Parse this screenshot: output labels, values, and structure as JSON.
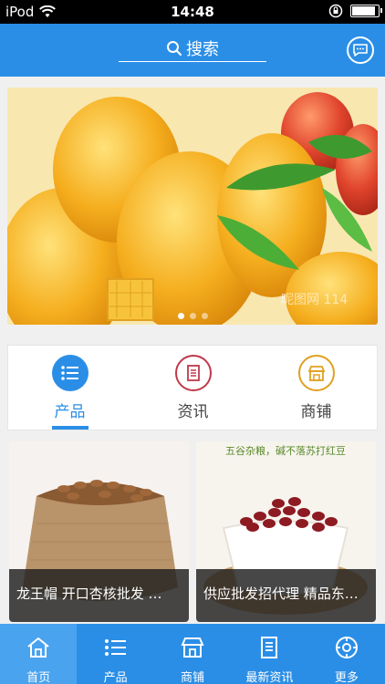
{
  "status_bar": {
    "device": "iPod",
    "time": "14:48"
  },
  "header": {
    "search_label": "搜索",
    "search_icon": "search-icon",
    "chat_icon": "chat-bubble-icon"
  },
  "banner": {
    "image_subject": "mangoes",
    "watermark": "昵图网 114",
    "slides": 3,
    "active_slide": 1
  },
  "categories": [
    {
      "label": "产品",
      "icon": "list-icon",
      "color": "#2b8ee6",
      "active": true
    },
    {
      "label": "资讯",
      "icon": "document-icon",
      "color": "#c0394b",
      "active": false
    },
    {
      "label": "商铺",
      "icon": "store-icon",
      "color": "#e0a020",
      "active": false
    }
  ],
  "products": [
    {
      "title": "龙王帽 开口杏核批发 …",
      "image": "apricot-kernels"
    },
    {
      "title": "供应批发招代理 精品东…",
      "image": "red-beans",
      "banner_text": "五谷杂粮，碱不落苏打红豆"
    }
  ],
  "bottom_nav": [
    {
      "label": "首页",
      "icon": "home-icon",
      "active": true
    },
    {
      "label": "产品",
      "icon": "list-icon",
      "active": false
    },
    {
      "label": "商铺",
      "icon": "store-icon",
      "active": false
    },
    {
      "label": "最新资讯",
      "icon": "document-icon",
      "active": false
    },
    {
      "label": "更多",
      "icon": "gear-icon",
      "active": false
    }
  ],
  "colors": {
    "primary": "#2b8ee6",
    "background": "#f0f0f0"
  }
}
